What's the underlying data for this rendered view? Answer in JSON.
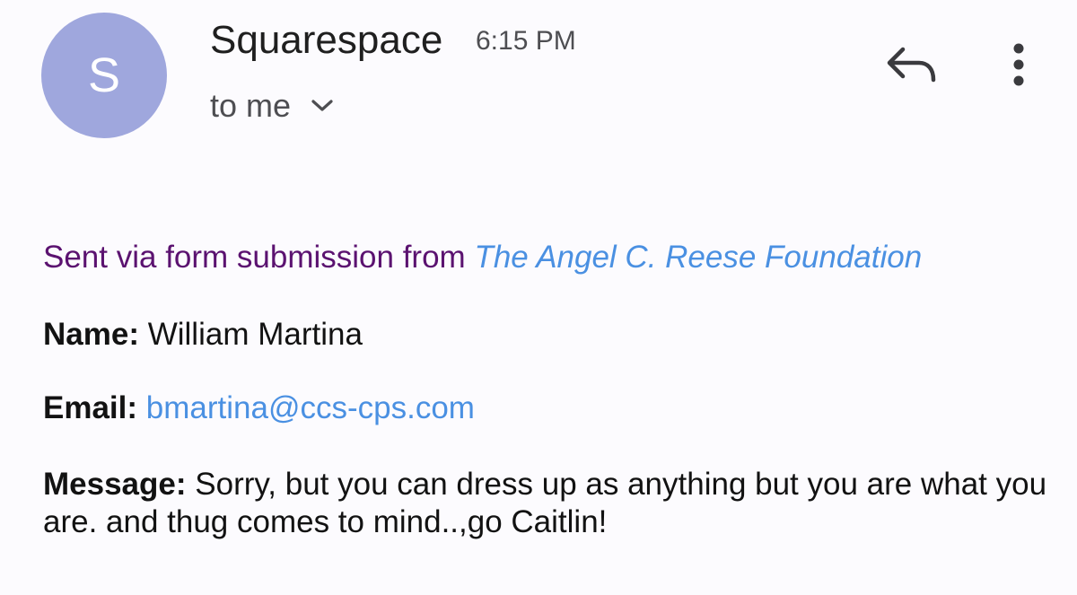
{
  "header": {
    "avatar_letter": "S",
    "avatar_color": "#9fa7dd",
    "sender_name": "Squarespace",
    "time": "6:15 PM",
    "recipient_text": "to me",
    "icons": [
      "chevron-down-icon",
      "reply-icon",
      "more-vert-icon"
    ]
  },
  "body": {
    "sent_via_text": "Sent via form submission from",
    "foundation_link": "The Angel C. Reese Foundation",
    "name_label": "Name:",
    "name_value": "William Martina",
    "email_label": "Email:",
    "email_value": "bmartina@ccs-cps.com",
    "message_label": "Message:",
    "message_value": "Sorry, but you can dress up as anything but you are what you are. and thug comes to mind..,go Caitlin!"
  },
  "colors": {
    "background": "#fcfbfe",
    "sent_via": "#5b1270",
    "link": "#4a90e2",
    "text": "#121212"
  }
}
